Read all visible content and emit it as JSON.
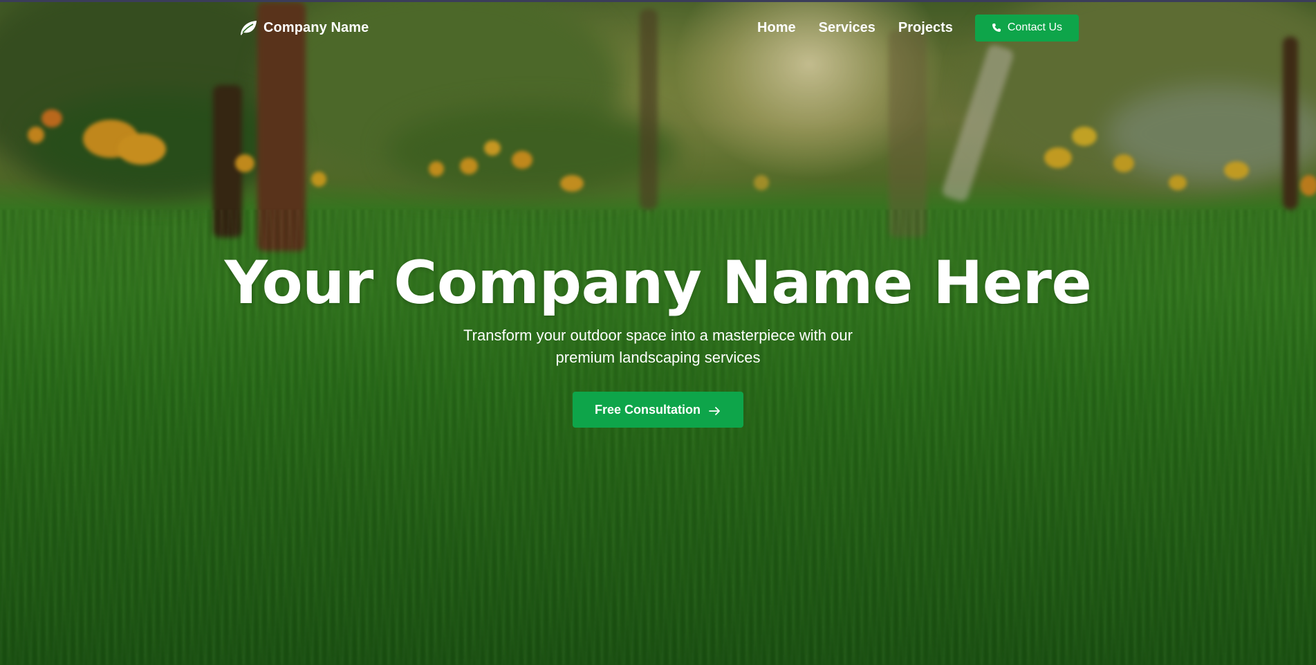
{
  "nav": {
    "brand": {
      "label": "Company Name",
      "icon": "leaf-icon"
    },
    "links": [
      {
        "label": "Home"
      },
      {
        "label": "Services"
      },
      {
        "label": "Projects"
      }
    ],
    "contact_button": {
      "label": "Contact Us",
      "icon": "phone-icon"
    }
  },
  "hero": {
    "title": "Your Company Name Here",
    "subtitle": "Transform your outdoor space into a masterpiece with our premium landscaping services",
    "cta": {
      "label": "Free Consultation",
      "icon": "arrow-right-icon"
    },
    "background": "blurred garden with green lawn, trees and orange flowers"
  },
  "colors": {
    "accent": "#0ea54a",
    "text": "#ffffff",
    "page_top_border": "#3b3d5a"
  }
}
